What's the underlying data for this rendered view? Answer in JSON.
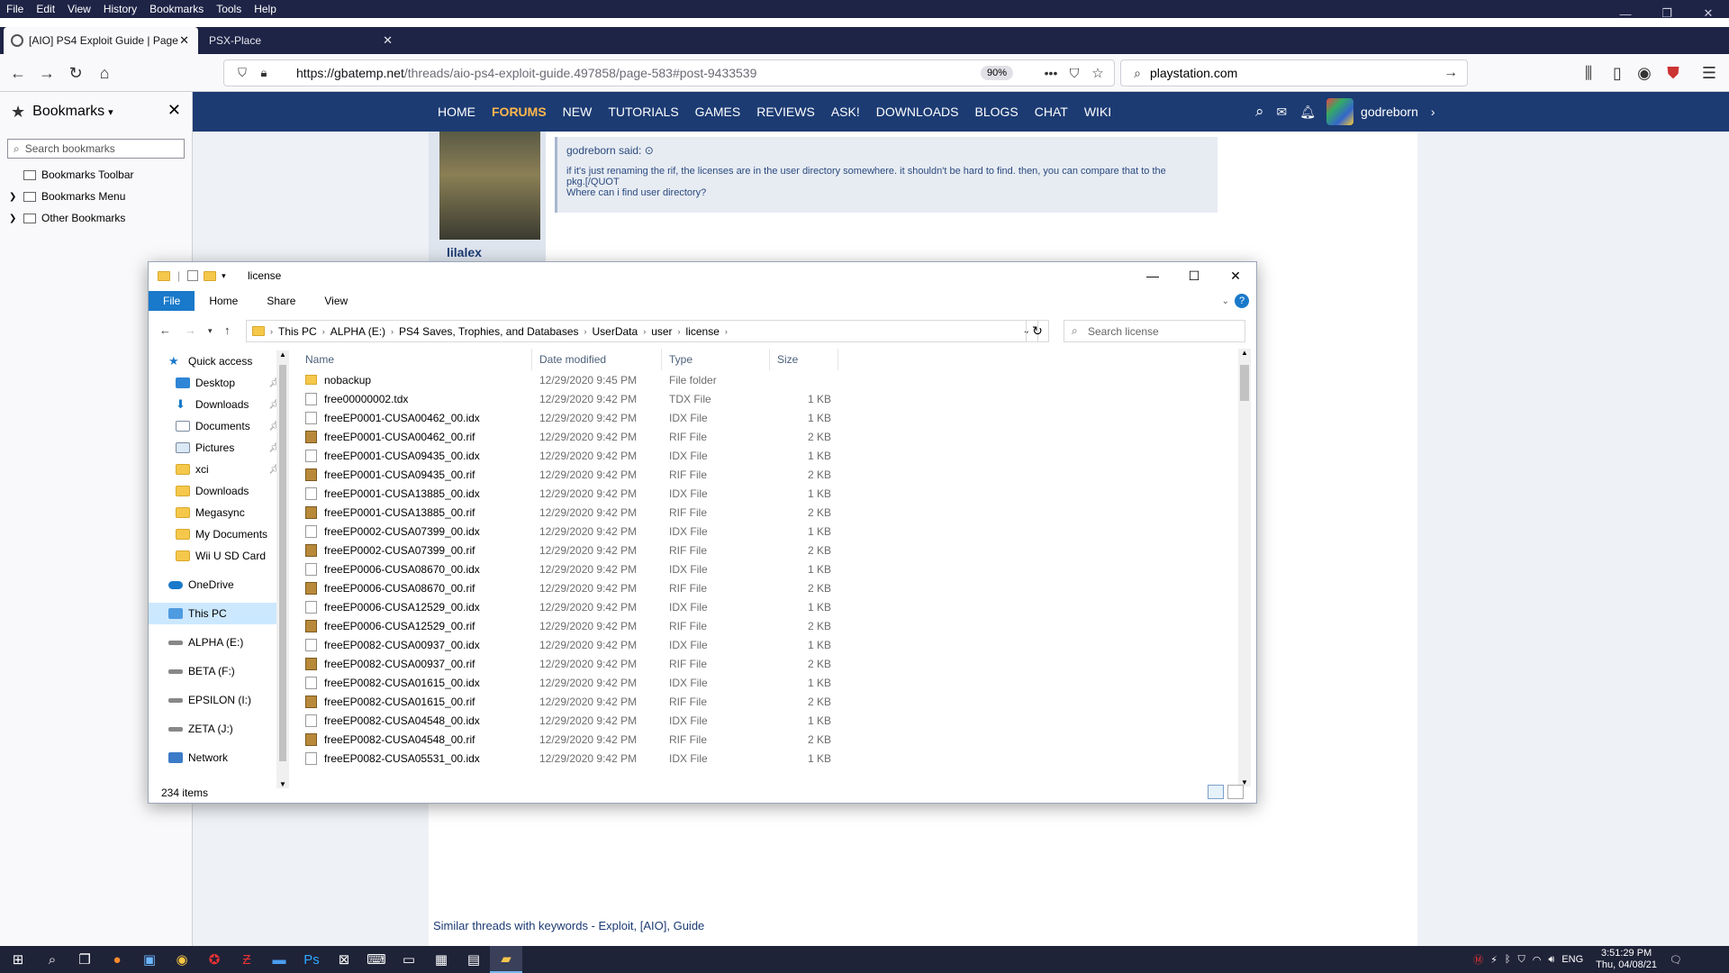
{
  "firefox": {
    "menu": [
      "File",
      "Edit",
      "View",
      "History",
      "Bookmarks",
      "Tools",
      "Help"
    ],
    "tabs": [
      {
        "title": "[AIO] PS4 Exploit Guide | Page"
      },
      {
        "title": "PSX-Place"
      }
    ],
    "url_domain": "https://gbatemp.net",
    "url_path": "/threads/aio-ps4-exploit-guide.497858/page-583#post-9433539",
    "zoom": "90%",
    "search_value": "playstation.com"
  },
  "bookmarks": {
    "title": "Bookmarks",
    "search_placeholder": "Search bookmarks",
    "items": [
      {
        "label": "Bookmarks Toolbar"
      },
      {
        "label": "Bookmarks Menu"
      },
      {
        "label": "Other Bookmarks"
      }
    ]
  },
  "site": {
    "nav": [
      "HOME",
      "FORUMS",
      "NEW",
      "TUTORIALS",
      "GAMES",
      "REVIEWS",
      "ASK!",
      "DOWNLOADS",
      "BLOGS",
      "CHAT",
      "WIKI"
    ],
    "username": "godreborn",
    "post_author": "lilalex",
    "quote_author": "godreborn said:",
    "quote_line1": "if it's just renaming the rif, the licenses are in the user directory somewhere. it shouldn't be hard to find. then, you can compare that to the",
    "quote_line2": "pkg.[/QUOT",
    "quote_line3": "Where can i find user directory?",
    "similar_title": "Similar threads with keywords - Exploit, [AIO], Guide"
  },
  "explorer": {
    "title": "license",
    "ribbon": {
      "file": "File",
      "home": "Home",
      "share": "Share",
      "view": "View",
      "help": "?"
    },
    "breadcrumb": [
      "This PC",
      "ALPHA (E:)",
      "PS4 Saves, Trophies, and Databases",
      "UserData",
      "user",
      "license"
    ],
    "search_placeholder": "Search license",
    "nav_pane": [
      {
        "label": "Quick access",
        "pinned": false
      },
      {
        "label": "Desktop",
        "pinned": true
      },
      {
        "label": "Downloads",
        "pinned": true
      },
      {
        "label": "Documents",
        "pinned": true
      },
      {
        "label": "Pictures",
        "pinned": true
      },
      {
        "label": "xci",
        "pinned": true
      },
      {
        "label": "Downloads",
        "pinned": false
      },
      {
        "label": "Megasync",
        "pinned": false
      },
      {
        "label": "My Documents",
        "pinned": false
      },
      {
        "label": "Wii U SD Card",
        "pinned": false
      },
      {
        "label": "OneDrive",
        "pinned": false
      },
      {
        "label": "This PC",
        "pinned": false
      },
      {
        "label": "ALPHA (E:)",
        "pinned": false
      },
      {
        "label": "BETA (F:)",
        "pinned": false
      },
      {
        "label": "EPSILON (I:)",
        "pinned": false
      },
      {
        "label": "ZETA (J:)",
        "pinned": false
      },
      {
        "label": "Network",
        "pinned": false
      }
    ],
    "columns": {
      "name": "Name",
      "date": "Date modified",
      "type": "Type",
      "size": "Size"
    },
    "files": [
      {
        "name": "nobackup",
        "date": "12/29/2020 9:45 PM",
        "type": "File folder",
        "size": "",
        "icon": "folder"
      },
      {
        "name": "free00000002.tdx",
        "date": "12/29/2020 9:42 PM",
        "type": "TDX File",
        "size": "1 KB",
        "icon": "doc"
      },
      {
        "name": "freeEP0001-CUSA00462_00.idx",
        "date": "12/29/2020 9:42 PM",
        "type": "IDX File",
        "size": "1 KB",
        "icon": "doc"
      },
      {
        "name": "freeEP0001-CUSA00462_00.rif",
        "date": "12/29/2020 9:42 PM",
        "type": "RIF File",
        "size": "2 KB",
        "icon": "rif"
      },
      {
        "name": "freeEP0001-CUSA09435_00.idx",
        "date": "12/29/2020 9:42 PM",
        "type": "IDX File",
        "size": "1 KB",
        "icon": "doc"
      },
      {
        "name": "freeEP0001-CUSA09435_00.rif",
        "date": "12/29/2020 9:42 PM",
        "type": "RIF File",
        "size": "2 KB",
        "icon": "rif"
      },
      {
        "name": "freeEP0001-CUSA13885_00.idx",
        "date": "12/29/2020 9:42 PM",
        "type": "IDX File",
        "size": "1 KB",
        "icon": "doc"
      },
      {
        "name": "freeEP0001-CUSA13885_00.rif",
        "date": "12/29/2020 9:42 PM",
        "type": "RIF File",
        "size": "2 KB",
        "icon": "rif"
      },
      {
        "name": "freeEP0002-CUSA07399_00.idx",
        "date": "12/29/2020 9:42 PM",
        "type": "IDX File",
        "size": "1 KB",
        "icon": "doc"
      },
      {
        "name": "freeEP0002-CUSA07399_00.rif",
        "date": "12/29/2020 9:42 PM",
        "type": "RIF File",
        "size": "2 KB",
        "icon": "rif"
      },
      {
        "name": "freeEP0006-CUSA08670_00.idx",
        "date": "12/29/2020 9:42 PM",
        "type": "IDX File",
        "size": "1 KB",
        "icon": "doc"
      },
      {
        "name": "freeEP0006-CUSA08670_00.rif",
        "date": "12/29/2020 9:42 PM",
        "type": "RIF File",
        "size": "2 KB",
        "icon": "rif"
      },
      {
        "name": "freeEP0006-CUSA12529_00.idx",
        "date": "12/29/2020 9:42 PM",
        "type": "IDX File",
        "size": "1 KB",
        "icon": "doc"
      },
      {
        "name": "freeEP0006-CUSA12529_00.rif",
        "date": "12/29/2020 9:42 PM",
        "type": "RIF File",
        "size": "2 KB",
        "icon": "rif"
      },
      {
        "name": "freeEP0082-CUSA00937_00.idx",
        "date": "12/29/2020 9:42 PM",
        "type": "IDX File",
        "size": "1 KB",
        "icon": "doc"
      },
      {
        "name": "freeEP0082-CUSA00937_00.rif",
        "date": "12/29/2020 9:42 PM",
        "type": "RIF File",
        "size": "2 KB",
        "icon": "rif"
      },
      {
        "name": "freeEP0082-CUSA01615_00.idx",
        "date": "12/29/2020 9:42 PM",
        "type": "IDX File",
        "size": "1 KB",
        "icon": "doc"
      },
      {
        "name": "freeEP0082-CUSA01615_00.rif",
        "date": "12/29/2020 9:42 PM",
        "type": "RIF File",
        "size": "2 KB",
        "icon": "rif"
      },
      {
        "name": "freeEP0082-CUSA04548_00.idx",
        "date": "12/29/2020 9:42 PM",
        "type": "IDX File",
        "size": "1 KB",
        "icon": "doc"
      },
      {
        "name": "freeEP0082-CUSA04548_00.rif",
        "date": "12/29/2020 9:42 PM",
        "type": "RIF File",
        "size": "2 KB",
        "icon": "rif"
      },
      {
        "name": "freeEP0082-CUSA05531_00.idx",
        "date": "12/29/2020 9:42 PM",
        "type": "IDX File",
        "size": "1 KB",
        "icon": "doc"
      }
    ],
    "status": "234 items"
  },
  "taskbar": {
    "lang": "ENG",
    "time": "3:51:29 PM",
    "date": "Thu, 04/08/21"
  }
}
